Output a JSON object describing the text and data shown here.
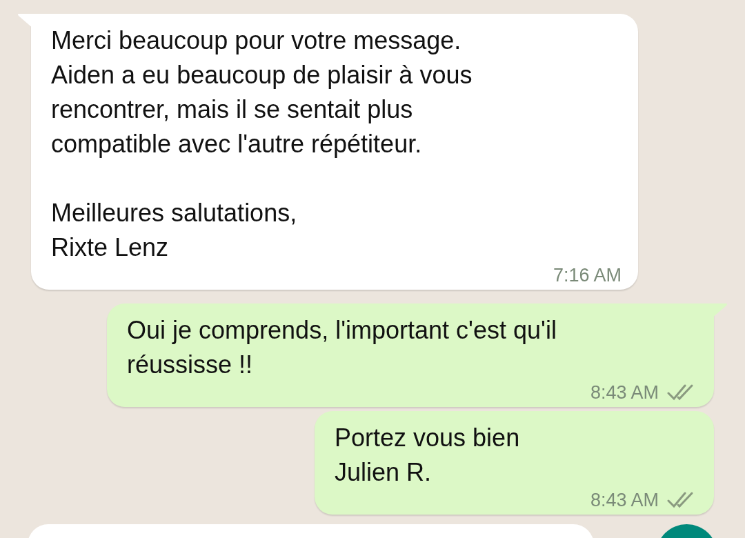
{
  "messages": [
    {
      "kind": "incoming",
      "text": "Merci beaucoup pour votre message.\nAiden a eu beaucoup de plaisir à vous\nrencontrer, mais il se sentait plus\ncompatible avec l'autre répétiteur.\n\nMeilleures salutations,\nRixte Lenz",
      "time": "7:16 AM",
      "tail": true
    },
    {
      "kind": "outgoing",
      "text": "Oui je comprends, l'important c'est qu'il\nréussisse !!",
      "time": "8:43 AM",
      "tail": true,
      "read": false
    },
    {
      "kind": "outgoing",
      "text": "Portez vous bien\nJulien R.",
      "time": "8:43 AM",
      "tail": false,
      "read": false
    }
  ]
}
